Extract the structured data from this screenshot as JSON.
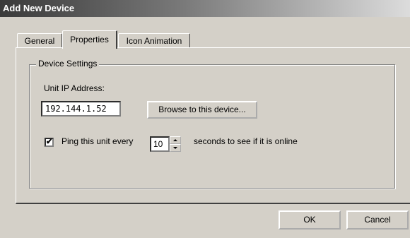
{
  "window": {
    "title": "Add New Device"
  },
  "tabs": [
    {
      "label": "General"
    },
    {
      "label": "Properties"
    },
    {
      "label": "Icon Animation"
    }
  ],
  "device_settings": {
    "group_label": "Device Settings",
    "ip_label": "Unit IP Address:",
    "ip_value": "192.144.1.52",
    "browse_label": "Browse to this device...",
    "ping_checked": true,
    "ping_label": "Ping this unit every",
    "ping_interval": "10",
    "ping_suffix": "seconds to see if it is online"
  },
  "buttons": {
    "ok": "OK",
    "cancel": "Cancel"
  }
}
